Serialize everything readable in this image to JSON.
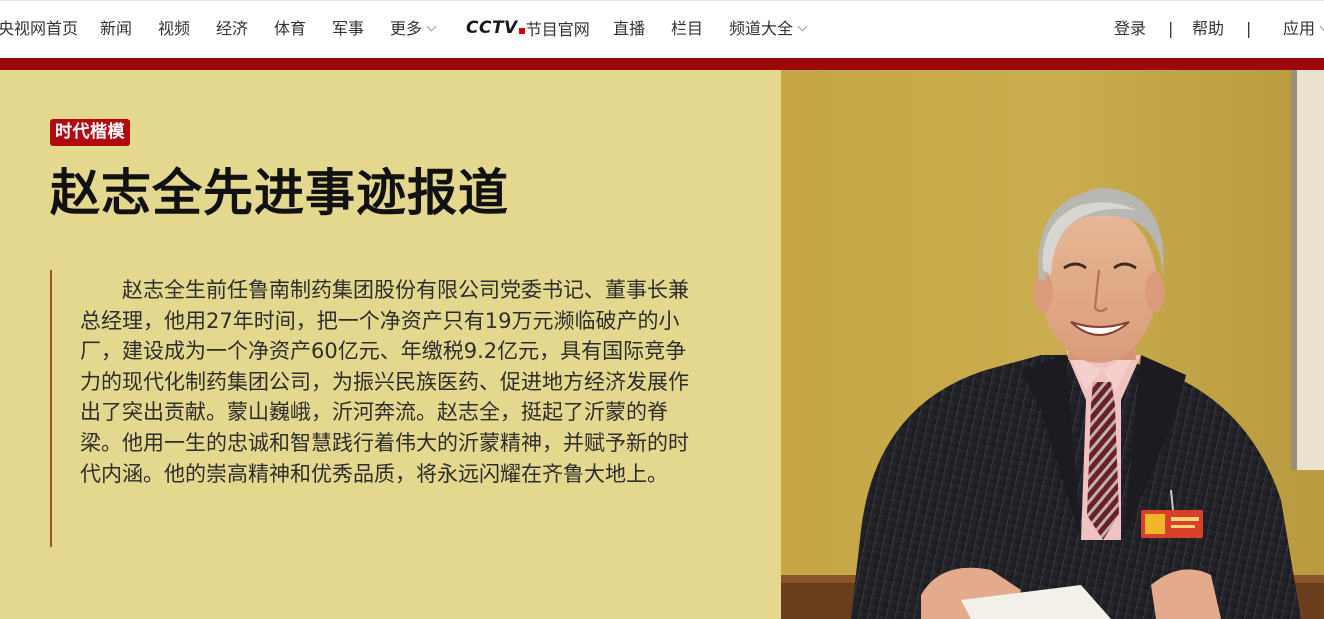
{
  "nav": {
    "left_items": [
      "央视网首页",
      "新闻",
      "视频",
      "经济",
      "体育",
      "军事",
      "更多"
    ],
    "logo_mark": "CCTV",
    "logo_text": "节目官网",
    "mid_items": [
      "直播",
      "栏目",
      "频道大全"
    ],
    "login": "登录",
    "help": "帮助",
    "apps": "应用",
    "separator": "|"
  },
  "colors": {
    "accent_red": "#9a0a0a",
    "badge_red": "#b10b12",
    "hero_bg": "#e4d78e"
  },
  "hero": {
    "badge": "时代楷模",
    "title": "赵志全先进事迹报道",
    "body": "赵志全生前任鲁南制药集团股份有限公司党委书记、董事长兼总经理，他用27年时间，把一个净资产只有19万元濒临破产的小厂，建设成为一个净资产60亿元、年缴税9.2亿元，具有国际竞争力的现代化制药集团公司，为振兴民族医药、促进地方经济发展作出了突出贡献。蒙山巍峨，沂河奔流。赵志全，挺起了沂蒙的脊梁。他用一生的忠诚和智慧践行着伟大的沂蒙精神，并赋予新的时代内涵。他的崇高精神和优秀品质，将永远闪耀在齐鲁大地上。"
  },
  "icons": {
    "more_dropdown": "chevron-down-icon",
    "channels_dropdown": "chevron-down-icon",
    "apps_dropdown": "chevron-down-icon"
  }
}
